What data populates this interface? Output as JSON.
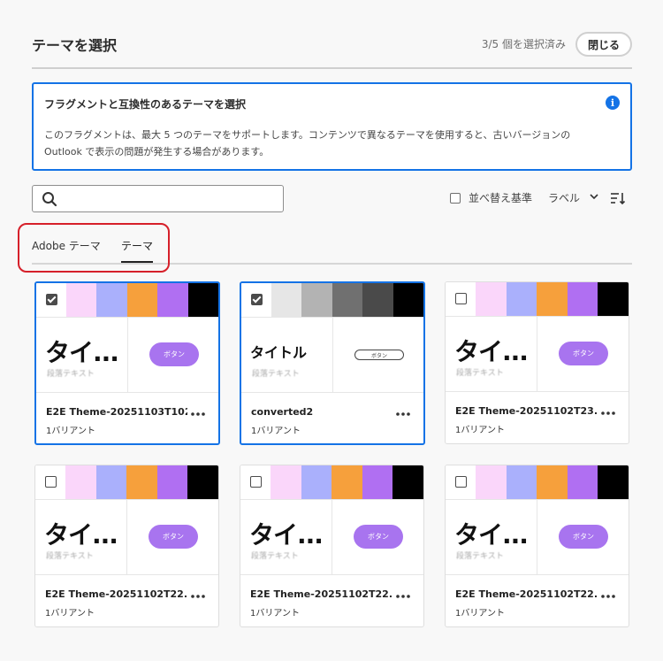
{
  "header": {
    "title": "テーマを選択",
    "selection_count": "3/5 個を選択済み",
    "close_label": "閉じる"
  },
  "info": {
    "title": "フラグメントと互換性のあるテーマを選択",
    "body": "このフラグメントは、最大 5 つのテーマをサポートします。コンテンツで異なるテーマを使用すると、古いバージョンの Outlook で表示の問題が発生する場合があります。"
  },
  "search": {
    "value": "",
    "placeholder": ""
  },
  "sort": {
    "label": "並べ替え基準",
    "field": "ラベル"
  },
  "tabs": [
    {
      "label": "Adobe テーマ",
      "active": false
    },
    {
      "label": "テーマ",
      "active": true
    }
  ],
  "cards": [
    {
      "name": "E2E Theme-20251103T102...",
      "variants": "1バリアント",
      "checked": true,
      "preview_title": "タイ...",
      "preview_body": "段落テキスト",
      "button_label": "ボタン",
      "colors": [
        "#fad6fa",
        "#aab0fc",
        "#f6a03c",
        "#b06ff2",
        "#000000"
      ]
    },
    {
      "name": "converted2",
      "variants": "1バリアント",
      "checked": true,
      "preview_title": "タイトル",
      "preview_body": "段落テキスト",
      "button_label": "ボタン",
      "colors": [
        "#e6e6e6",
        "#b3b3b3",
        "#707070",
        "#4a4a4a",
        "#000000"
      ]
    },
    {
      "name": "E2E Theme-20251102T23...",
      "variants": "1バリアント",
      "checked": false,
      "preview_title": "タイ...",
      "preview_body": "段落テキスト",
      "button_label": "ボタン",
      "colors": [
        "#fad6fa",
        "#aab0fc",
        "#f6a03c",
        "#b06ff2",
        "#000000"
      ]
    },
    {
      "name": "E2E Theme-20251102T22...",
      "variants": "1バリアント",
      "checked": false,
      "preview_title": "タイ...",
      "preview_body": "段落テキスト",
      "button_label": "ボタン",
      "colors": [
        "#fad6fa",
        "#aab0fc",
        "#f6a03c",
        "#b06ff2",
        "#000000"
      ]
    },
    {
      "name": "E2E Theme-20251102T22...",
      "variants": "1バリアント",
      "checked": false,
      "preview_title": "タイ...",
      "preview_body": "段落テキスト",
      "button_label": "ボタン",
      "colors": [
        "#fad6fa",
        "#aab0fc",
        "#f6a03c",
        "#b06ff2",
        "#000000"
      ]
    },
    {
      "name": "E2E Theme-20251102T22...",
      "variants": "1バリアント",
      "checked": false,
      "preview_title": "タイ...",
      "preview_body": "段落テキスト",
      "button_label": "ボタン",
      "colors": [
        "#fad6fa",
        "#aab0fc",
        "#f6a03c",
        "#b06ff2",
        "#000000"
      ]
    }
  ],
  "colors": {
    "accent": "#1473e6",
    "highlight": "#d6202a",
    "button": "#a874ef"
  }
}
